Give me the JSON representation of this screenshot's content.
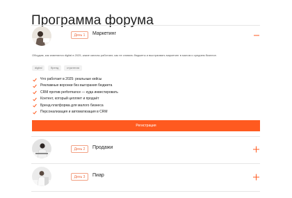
{
  "page": {
    "title": "Программа форума"
  },
  "colors": {
    "accent": "#ff5a1f",
    "badge_border": "#f2a184",
    "badge_text": "#ee6a3e"
  },
  "sessions": [
    {
      "day": "День 1",
      "topic": "Маркетинг",
      "expanded": true,
      "toggle_icon": "minus-icon",
      "description": "Обсудим, как изменился digital в 2025, какие каналы работают, как не сливать бюджеты и выстраивать маркетинг в малом и среднем бизнесе.",
      "tags": [
        "digital",
        "бренд",
        "стратегия"
      ],
      "items": [
        "Что работает в 2025: реальные кейсы",
        "Рекламные воронки без выгорания бюджета",
        "CRM против performance — куда инвестировать",
        "Контент, который цепляет и продаёт",
        "Бренд-платформа для малого бизнеса",
        "Персонализация и автоматизация в CRM"
      ],
      "button_label": "Регистрация"
    },
    {
      "day": "День 2",
      "topic": "Продажи",
      "expanded": false,
      "toggle_icon": "plus-icon"
    },
    {
      "day": "День 3",
      "topic": "Пиар",
      "expanded": false,
      "toggle_icon": "plus-icon"
    }
  ]
}
